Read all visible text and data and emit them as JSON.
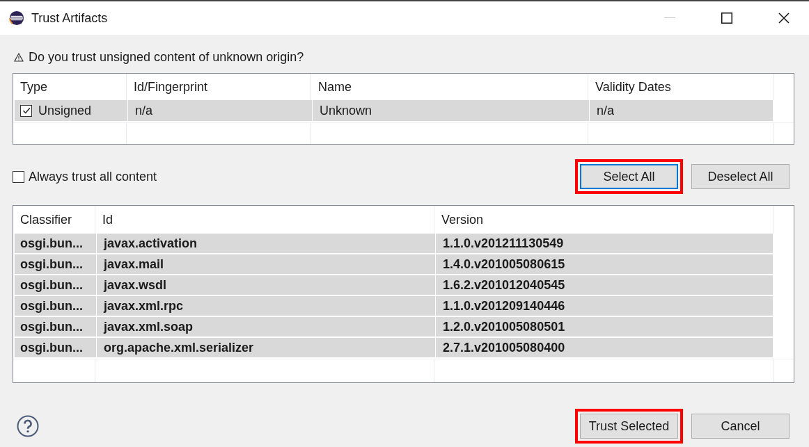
{
  "window": {
    "title": "Trust Artifacts"
  },
  "question": {
    "text": "Do you trust unsigned content of unknown origin?"
  },
  "signers": {
    "columns": [
      "Type",
      "Id/Fingerprint",
      "Name",
      "Validity Dates"
    ],
    "rows": [
      {
        "checked": true,
        "selected": true,
        "cells": [
          "Unsigned",
          "n/a",
          "Unknown",
          "n/a"
        ]
      }
    ]
  },
  "always_trust": {
    "label": "Always trust all content",
    "checked": false
  },
  "select_buttons": [
    {
      "label": "Select All",
      "focused": true,
      "highlighted": true
    },
    {
      "label": "Deselect All",
      "focused": false,
      "highlighted": false
    }
  ],
  "artifacts": {
    "columns": [
      "Classifier",
      "Id",
      "Version"
    ],
    "rows": [
      {
        "selected": true,
        "cells": [
          "osgi.bun...",
          "javax.activation",
          "1.1.0.v201211130549"
        ]
      },
      {
        "selected": true,
        "cells": [
          "osgi.bun...",
          "javax.mail",
          "1.4.0.v201005080615"
        ]
      },
      {
        "selected": true,
        "cells": [
          "osgi.bun...",
          "javax.wsdl",
          "1.6.2.v201012040545"
        ]
      },
      {
        "selected": true,
        "cells": [
          "osgi.bun...",
          "javax.xml.rpc",
          "1.1.0.v201209140446"
        ]
      },
      {
        "selected": true,
        "cells": [
          "osgi.bun...",
          "javax.xml.soap",
          "1.2.0.v201005080501"
        ]
      },
      {
        "selected": true,
        "cells": [
          "osgi.bun...",
          "org.apache.xml.serializer",
          "2.7.1.v201005080400"
        ]
      }
    ]
  },
  "footer_buttons": [
    {
      "label": "Trust Selected",
      "focused": false,
      "highlighted": true
    },
    {
      "label": "Cancel",
      "focused": false,
      "highlighted": false
    }
  ]
}
